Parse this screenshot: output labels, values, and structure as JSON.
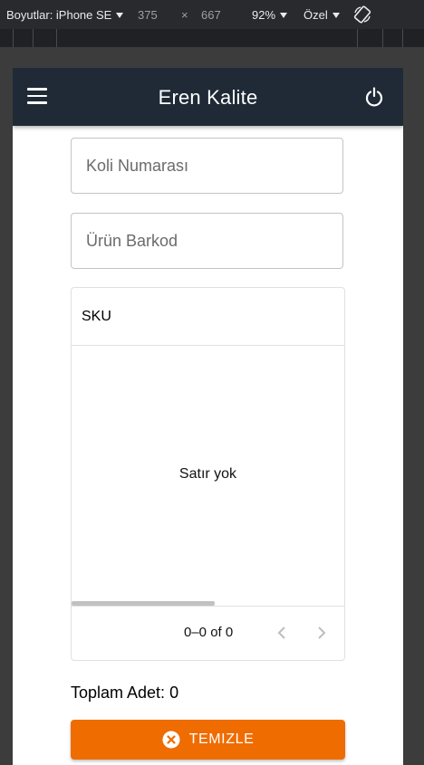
{
  "devtools": {
    "dimensions_label": "Boyutlar: iPhone SE",
    "width": "375",
    "times": "×",
    "height": "667",
    "zoom": "92%",
    "throttle": "Özel"
  },
  "app": {
    "title": "Eren Kalite"
  },
  "form": {
    "koli_placeholder": "Koli Numarası",
    "barkod_placeholder": "Ürün Barkod"
  },
  "grid": {
    "columns": [
      "SKU"
    ],
    "empty_text": "Satır yok",
    "pagination": "0–0 of 0"
  },
  "summary": {
    "total_label": "Toplam Adet: 0"
  },
  "actions": {
    "clear_label": "TEMIZLE",
    "clear_color": "#ef6c00"
  },
  "colors": {
    "appbar": "#1f2a36"
  }
}
